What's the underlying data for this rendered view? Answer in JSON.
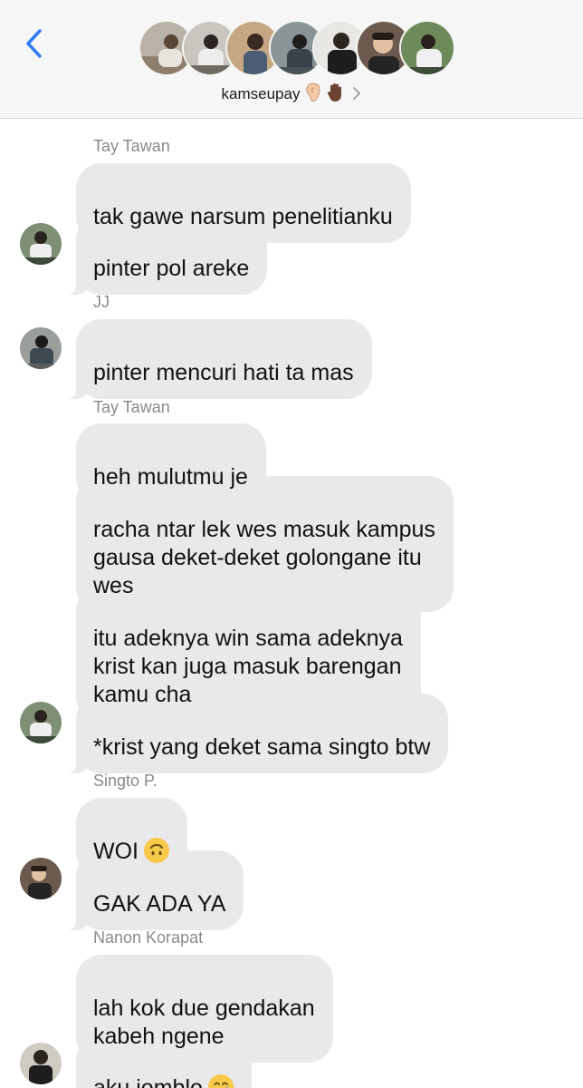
{
  "header": {
    "group_name": "kamseupay",
    "emojis": [
      "ear-emoji",
      "raised-hand-emoji"
    ]
  },
  "messages": [
    {
      "sender": "Tay Tawan",
      "bubbles": [
        "tak gawe narsum penelitianku",
        "pinter pol areke"
      ]
    },
    {
      "sender": "JJ",
      "bubbles": [
        "pinter mencuri hati ta mas"
      ]
    },
    {
      "sender": "Tay Tawan",
      "bubbles": [
        "heh mulutmu je",
        "racha ntar lek wes masuk kampus\ngausa deket-deket golongane itu\nwes",
        "itu adeknya win sama adeknya\nkrist kan juga masuk barengan\nkamu cha",
        "*krist yang deket sama singto btw"
      ]
    },
    {
      "sender": "Singto P.",
      "bubbles": [
        "WOI",
        "GAK ADA YA"
      ]
    },
    {
      "sender": "Nanon Korapat",
      "bubbles": [
        "lah kok due gendakan\nkabeh ngene",
        "aku jomblo"
      ]
    }
  ],
  "colors": {
    "accent": "#2f7cf6",
    "bubble": "#e9e9eb",
    "sender": "#8a8a8e"
  }
}
